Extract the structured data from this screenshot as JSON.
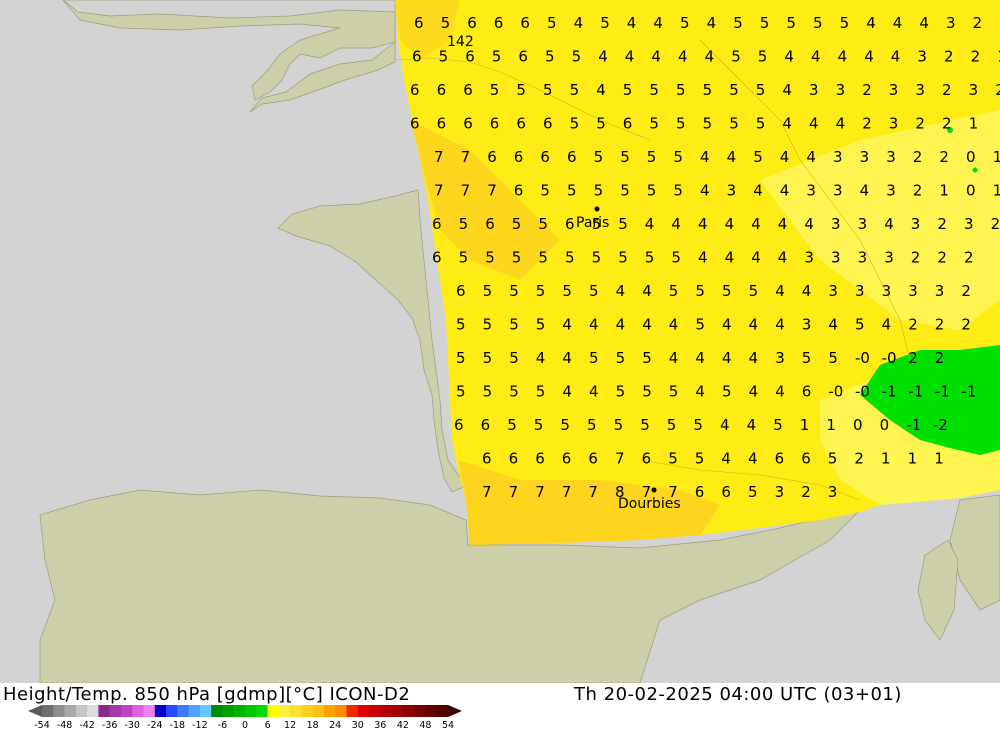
{
  "map": {
    "contour_label": "142",
    "cities": [
      {
        "name": "Paris"
      },
      {
        "name": "Dourbies"
      }
    ],
    "temperature_rows": [
      "6 5 6 6 6 5 4 5 4 4 5 4 5 5 5 5 5 4 4 4 3 2 2",
      "6 5 6 5 6 5 5 4 4 4 4 4 5 5 4 4 4 4 4 3 2 2 1",
      "6 6 6 5 5 5 5 4 5 5 5 5 5 5 4 3 3 2 3 3 2 3 2",
      "6 6 6 6 6 6 5 5 6 5 5 5 5 5 4 4 4 2 3 2 2 1",
      "7 7 6 6 6 6 5 5 5 5 4 4 5 4 4 3 3 3 2 2 0 1",
      "7 7 7 6 5 5 5 5 5 5 4 3 4 4 3 3 4 3 2 1 0 1",
      "6 5 6 5 5 6 5 5 4 4 4 4 4 4 4 3 3 4 3 2 3 2 2",
      "6 5 5 5 5 5 5 5 5 5 4 4 4 4 3 3 3 3 2 2 2",
      "6 5 5 5 5 5 4 4 5 5 5 5 4 4 3 3 3 3 3 2",
      "5 5 5 5 4 4 4 4 4 5 4 4 4 3 4 5 4 2 2 2",
      "5 5 5 4 4 5 5 5 4 4 4 4 3 5 5 -0 -0 2 2",
      "5 5 5 5 4 4 5 5 5 4 5 4 4 6 -0 -0 -1 -1 -1 -1",
      "6 6 5 5 5 5 5 5 5 5 4 4 5 1 1 0 0 -1 -2",
      "6 6 6 6 6 7 6 5 5 4 4 6 6 5 2 1 1 1",
      "7 7 7 7 7 8 7 7 6 6 5 3 2 3"
    ]
  },
  "footer": {
    "title": "Height/Temp. 850 hPa [gdmp][°C] ICON-D2",
    "datetime": "Th 20-02-2025 04:00 UTC (03+01)"
  },
  "legend": {
    "labels": [
      "-54",
      "-48",
      "-42",
      "-36",
      "-30",
      "-24",
      "-18",
      "-12",
      "-6",
      "0",
      "6",
      "12",
      "18",
      "24",
      "30",
      "36",
      "42",
      "48",
      "54"
    ],
    "colors": [
      "#6e6e6e",
      "#8c8c8c",
      "#a8a8a8",
      "#c4c4c4",
      "#dcdcdc",
      "#8a2a8a",
      "#a33aa3",
      "#c040c0",
      "#e060e0",
      "#f080f0",
      "#0000c8",
      "#2848ff",
      "#3c78ff",
      "#50a0ff",
      "#64c8ff",
      "#008c00",
      "#00a000",
      "#00b400",
      "#00c800",
      "#00dc00",
      "#ffff00",
      "#fff040",
      "#ffe030",
      "#ffd020",
      "#ffc010",
      "#ffa000",
      "#ff8c00",
      "#f02800",
      "#e00000",
      "#c80000",
      "#b40000",
      "#a00000",
      "#8c0000",
      "#780000",
      "#640000",
      "#500000"
    ]
  }
}
